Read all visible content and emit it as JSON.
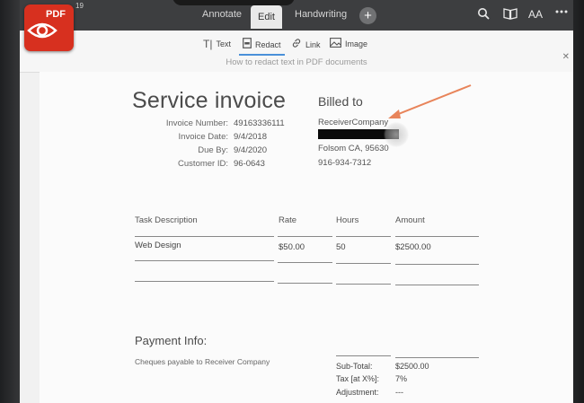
{
  "toolbar": {
    "status_number": "19",
    "tabs": [
      {
        "label": "Annotate"
      },
      {
        "label": "Edit"
      },
      {
        "label": "Handwriting"
      }
    ],
    "plus_label": "+",
    "font_label": "AA"
  },
  "edit_tools": [
    {
      "label": "Text"
    },
    {
      "label": "Redact"
    },
    {
      "label": "Link"
    },
    {
      "label": "Image"
    }
  ],
  "hint_text": "How to redact text in PDF documents",
  "app_badge": "PDF",
  "invoice": {
    "title": "Service invoice",
    "billed_to_heading": "Billed to",
    "fields": [
      {
        "label": "Invoice Number:",
        "value": "49163336111"
      },
      {
        "label": "Invoice Date:",
        "value": "9/4/2018"
      },
      {
        "label": "Due By:",
        "value": "9/4/2020"
      },
      {
        "label": "Customer ID:",
        "value": "96-0643"
      }
    ],
    "billed_to": {
      "company": "ReceiverCompany",
      "city": "Folsom CA, 95630",
      "phone": "916-934-7312"
    },
    "table_headers": {
      "task": "Task Description",
      "rate": "Rate",
      "hours": "Hours",
      "amount": "Amount"
    },
    "rows": [
      {
        "task": "Web Design",
        "rate": "$50.00",
        "hours": "50",
        "amount": "$2500.00"
      }
    ],
    "payment_heading": "Payment Info:",
    "payment_note": "Cheques payable to Receiver Company",
    "totals": [
      {
        "label": "Sub-Total:",
        "value": "$2500.00"
      },
      {
        "label": "Tax [at X%]:",
        "value": "7%"
      },
      {
        "label": "Adjustment:",
        "value": "---"
      }
    ]
  },
  "colors": {
    "accent": "#4a90d9",
    "annotation_arrow": "#e8845a",
    "badge": "#d7301f"
  }
}
